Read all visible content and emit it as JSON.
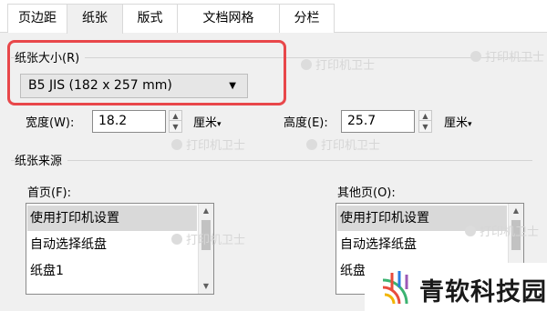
{
  "tabs": [
    {
      "label": "页边距",
      "active": false
    },
    {
      "label": "纸张",
      "active": true
    },
    {
      "label": "版式",
      "active": false
    },
    {
      "label": "文档网格",
      "active": false
    },
    {
      "label": "分栏",
      "active": false
    }
  ],
  "paper_size": {
    "group_title": "纸张大小(R)",
    "selected": "B5 JIS (182 x 257 mm)"
  },
  "width": {
    "label": "宽度(W):",
    "value": "18.2",
    "unit": "厘米"
  },
  "height": {
    "label": "高度(E):",
    "value": "25.7",
    "unit": "厘米"
  },
  "paper_source": {
    "group_title": "纸张来源",
    "first_page": {
      "label": "首页(F):",
      "items": [
        "使用打印机设置",
        "自动选择纸盘",
        "纸盘1"
      ],
      "selected_index": 0
    },
    "other_pages": {
      "label": "其他页(O):",
      "items": [
        "使用打印机设置",
        "自动选择纸盘",
        "纸盘1"
      ],
      "selected_index": 0
    }
  },
  "watermark": {
    "text": "打印机卫士"
  },
  "logo": {
    "text": "青软科技园"
  },
  "colors": {
    "highlight": "#e8474a",
    "dialog_bg": "#f0f0f0",
    "selection": "#d9d9d9"
  }
}
